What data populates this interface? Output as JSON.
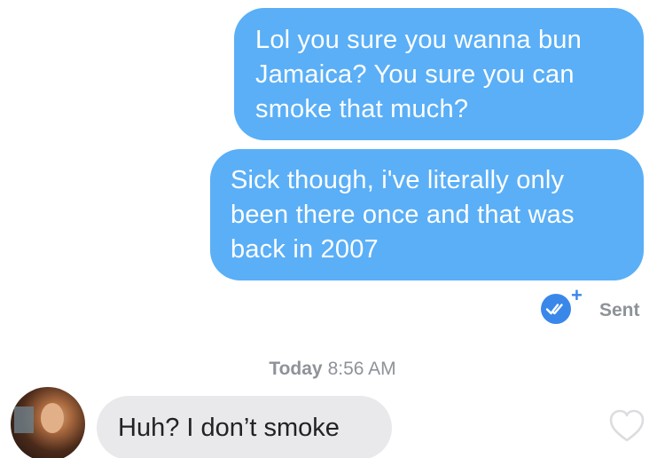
{
  "messages_outgoing": [
    {
      "text": "Lol you sure you wanna bun\nJamaica? You sure you can\nsmoke that much?"
    },
    {
      "text": "Sick though, i've literally only\nbeen there once and that was\nback in 2007"
    }
  ],
  "receipt": {
    "status_label": "Sent",
    "icon": "double-check-icon",
    "plus_glyph": "+"
  },
  "timestamp": {
    "day": "Today",
    "time": "8:56 AM"
  },
  "message_incoming": {
    "text": "Huh? I don’t smoke"
  },
  "colors": {
    "outgoing_bubble": "#5aaff7",
    "incoming_bubble": "#e9e9ec",
    "receipt_icon": "#3a87ea",
    "muted_text": "#8e9299"
  }
}
